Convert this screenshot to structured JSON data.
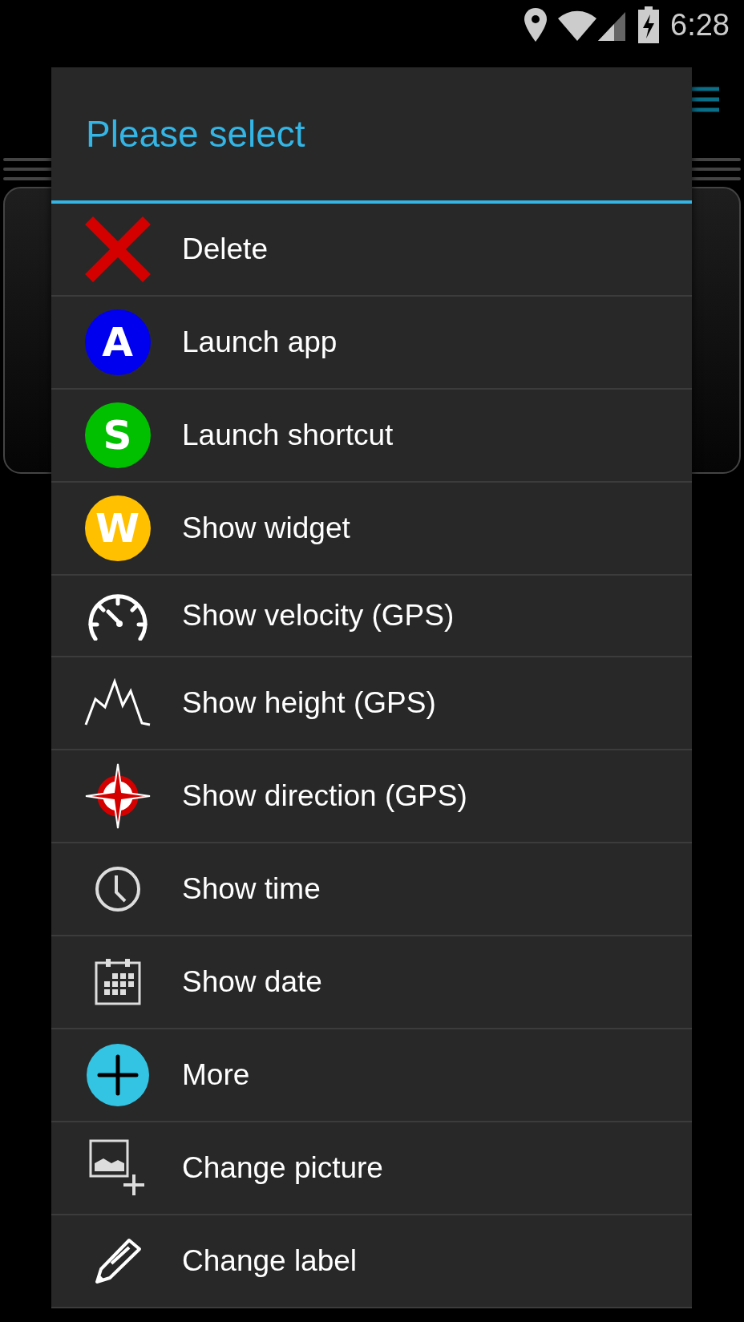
{
  "status_bar": {
    "time": "6:28"
  },
  "dialog": {
    "title": "Please select",
    "items": [
      {
        "label": "Delete",
        "kind": "cross"
      },
      {
        "label": "Launch app",
        "kind": "letter",
        "letter": "A",
        "color": "#0000ee"
      },
      {
        "label": "Launch shortcut",
        "kind": "letter",
        "letter": "S",
        "color": "#00c000"
      },
      {
        "label": "Show widget",
        "kind": "letter",
        "letter": "W",
        "color": "#ffc000"
      },
      {
        "label": "Show velocity (GPS)",
        "kind": "speedometer"
      },
      {
        "label": "Show height (GPS)",
        "kind": "mountain"
      },
      {
        "label": "Show direction (GPS)",
        "kind": "compass"
      },
      {
        "label": "Show time",
        "kind": "clock"
      },
      {
        "label": "Show date",
        "kind": "calendar"
      },
      {
        "label": "More",
        "kind": "plus"
      },
      {
        "label": "Change picture",
        "kind": "picture"
      },
      {
        "label": "Change label",
        "kind": "pencil"
      }
    ]
  }
}
